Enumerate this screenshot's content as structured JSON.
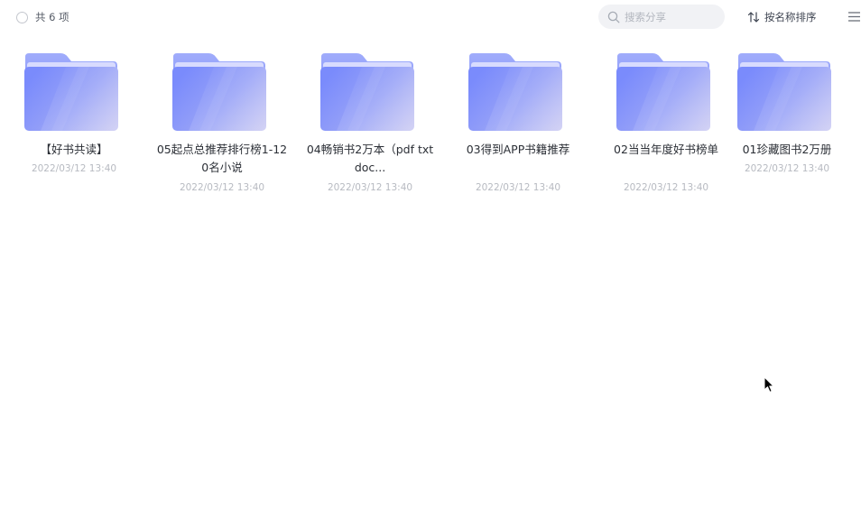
{
  "toolbar": {
    "count_label": "共 6 项",
    "search_placeholder": "搜索分享",
    "sort_label": "按名称排序"
  },
  "folders": [
    {
      "name": "【好书共读】",
      "date": "2022/03/12 13:40"
    },
    {
      "name": "05起点总推荐排行榜1-120名小说",
      "date": "2022/03/12 13:40"
    },
    {
      "name": "04畅销书2万本（pdf txt doc...",
      "date": "2022/03/12 13:40"
    },
    {
      "name": "03得到APP书籍推荐",
      "date": "2022/03/12 13:40"
    },
    {
      "name": "02当当年度好书榜单",
      "date": "2022/03/12 13:40"
    },
    {
      "name": "01珍藏图书2万册",
      "date": "2022/03/12 13:40"
    }
  ],
  "colors": {
    "folder_back": "#9aa7fb",
    "folder_front": "#7f8ffb",
    "accent": "#7b8cff"
  },
  "icons": {
    "folder": "folder-icon",
    "search": "search-icon",
    "sort": "sort-arrows-icon",
    "menu": "hamburger-menu-icon",
    "cursor": "mouse-pointer-icon"
  }
}
